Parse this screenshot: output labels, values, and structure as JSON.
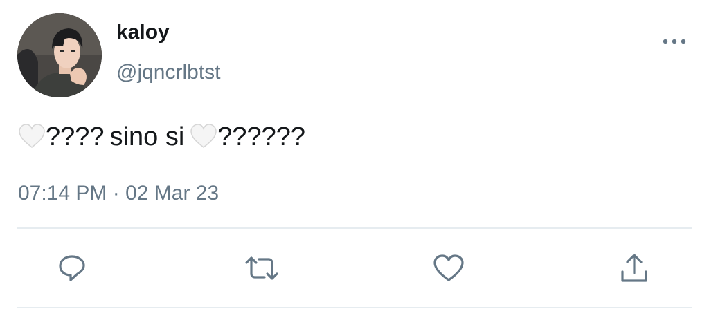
{
  "tweet": {
    "display_name": "kaloy",
    "handle": "@jqncrlbtst",
    "text_parts": {
      "part1": "????",
      "part2": "sino si",
      "part3": "??????"
    },
    "emoji": "white-heart",
    "timestamp": "07:14 PM · 02 Mar 23"
  },
  "actions": {
    "reply_icon": "speech-bubble-icon",
    "retweet_icon": "retweet-icon",
    "like_icon": "heart-icon",
    "share_icon": "share-upload-icon"
  },
  "colors": {
    "text": "#14171a",
    "secondary": "#657786",
    "divider": "#e6ecf0",
    "icon": "#657786"
  }
}
